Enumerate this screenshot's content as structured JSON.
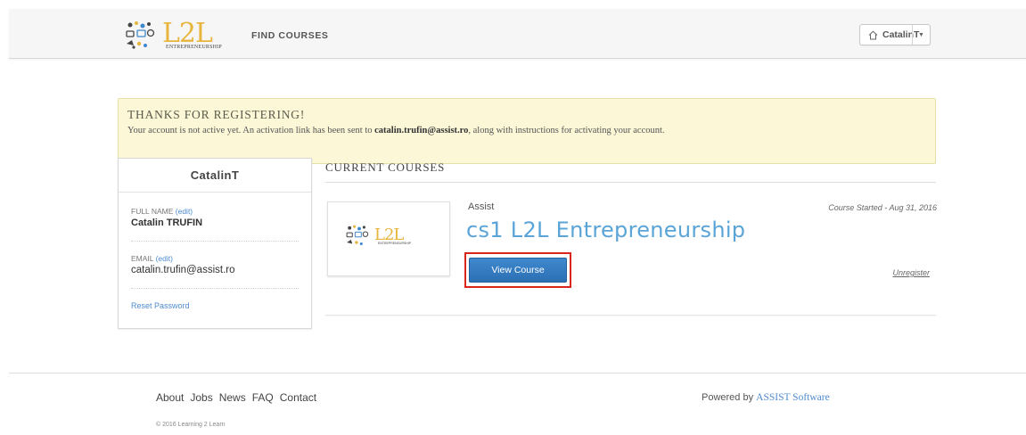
{
  "header": {
    "logo_text": "L2L",
    "logo_sub": "ENTREPRENEURSHIP",
    "nav_find": "FIND COURSES",
    "username": "CatalinT"
  },
  "notice": {
    "title": "THANKS FOR REGISTERING!",
    "body_before": "Your account is not active yet. An activation link has been sent to ",
    "email": "catalin.trufin@assist.ro",
    "body_after": ", along with instructions for activating your account."
  },
  "profile": {
    "username": "CatalinT",
    "full_name_label": "FULL NAME",
    "full_name_edit": "(edit)",
    "full_name": "Catalin TRUFIN",
    "email_label": "EMAIL",
    "email_edit": "(edit)",
    "email": "catalin.trufin@assist.ro",
    "reset": "Reset Password"
  },
  "courses": {
    "title": "CURRENT COURSES",
    "items": [
      {
        "org": "Assist",
        "name": "cs1 L2L Entrepreneurship",
        "date": "Course Started - Aug 31, 2016",
        "view": "View Course",
        "unregister": "Unregister",
        "thumb_text": "L2L",
        "thumb_sub": "ENTREPRENEURSHIP"
      }
    ]
  },
  "footer": {
    "links": [
      "About",
      "Jobs",
      "News",
      "FAQ",
      "Contact"
    ],
    "powered_prefix": "Powered by",
    "powered_brand": "ASSIST Software",
    "copyright": "© 2016 Learning 2 Learn"
  },
  "colors": {
    "accent": "#4e8bd1",
    "button": "#3379c0",
    "notice_bg": "#fbf7d7",
    "highlight": "#d9261c",
    "logo": "#e7b53d"
  }
}
